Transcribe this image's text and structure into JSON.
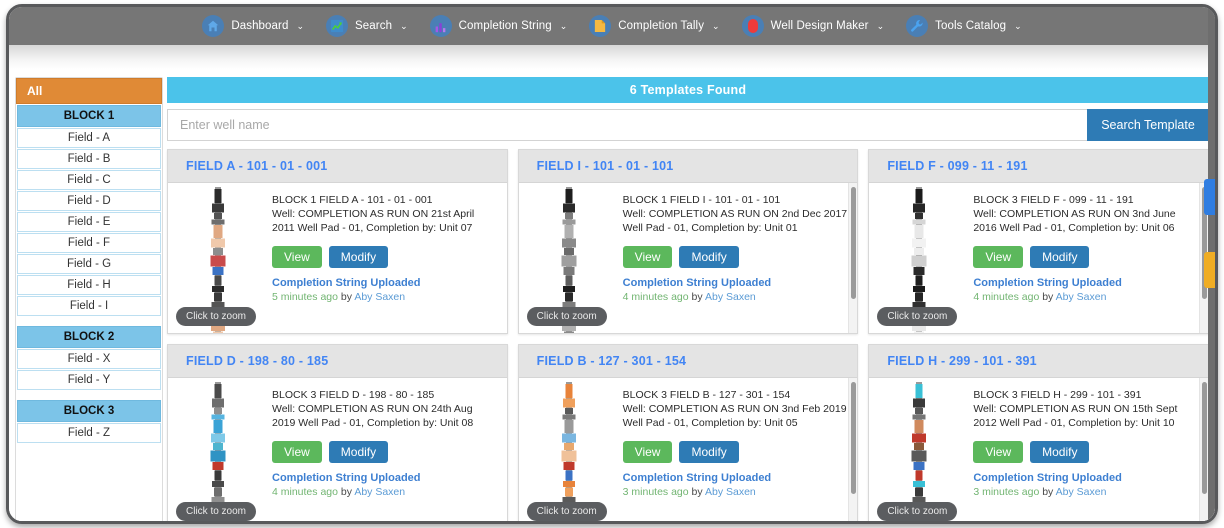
{
  "nav": {
    "items": [
      {
        "label": "Dashboard",
        "icon": "home-icon",
        "caret": "⌄"
      },
      {
        "label": "Search",
        "icon": "chart-line-icon",
        "caret": "⌄"
      },
      {
        "label": "Completion String",
        "icon": "bar-chart-icon",
        "caret": "⌄"
      },
      {
        "label": "Completion Tally",
        "icon": "document-icon",
        "caret": "⌄"
      },
      {
        "label": "Well Design Maker",
        "icon": "capsule-icon",
        "caret": "⌄"
      },
      {
        "label": "Tools Catalog",
        "icon": "wrench-icon",
        "caret": "⌄"
      }
    ]
  },
  "sidebar": {
    "all_label": "All",
    "groups": [
      {
        "block": "BLOCK 1",
        "fields": [
          "Field - A",
          "Field - B",
          "Field - C",
          "Field - D",
          "Field - E",
          "Field - F",
          "Field - G",
          "Field - H",
          "Field - I"
        ]
      },
      {
        "block": "BLOCK 2",
        "fields": [
          "Field - X",
          "Field - Y"
        ]
      },
      {
        "block": "BLOCK 3",
        "fields": [
          "Field - Z"
        ]
      }
    ]
  },
  "main": {
    "found_label": "6 Templates Found",
    "search": {
      "placeholder": "Enter well name",
      "value": "",
      "button_label": "Search Template"
    },
    "labels": {
      "view": "View",
      "modify": "Modify",
      "status": "Completion String Uploaded",
      "by": "by",
      "zoom": "Click to zoom"
    },
    "cards": [
      {
        "title": "FIELD A - 101 - 01 - 001",
        "line1": "BLOCK 1 FIELD A - 101 - 01 - 001",
        "line2": "Well: COMPLETION AS RUN ON 21st April",
        "line3": "2011 Well Pad - 01, Completion by: Unit 07",
        "ago": "5 minutes ago",
        "user": "Aby Saxen",
        "scroll": false
      },
      {
        "title": "FIELD I - 101 - 01 - 101",
        "line1": "BLOCK 1 FIELD I - 101 - 01 - 101",
        "line2": "Well: COMPLETION AS RUN ON 2nd Dec 2017",
        "line3": "Well Pad - 01, Completion by: Unit 01",
        "ago": "4 minutes ago",
        "user": "Aby Saxen",
        "scroll": true
      },
      {
        "title": "FIELD F - 099 - 11 - 191",
        "line1": "BLOCK 3 FIELD F - 099 - 11 - 191",
        "line2": "Well: COMPLETION AS RUN ON 3nd June",
        "line3": "2016 Well Pad - 01, Completion by: Unit 06",
        "ago": "4 minutes ago",
        "user": "Aby Saxen",
        "scroll": true
      },
      {
        "title": "FIELD D - 198 - 80 - 185",
        "line1": "BLOCK 3 FIELD D - 198 - 80 - 185",
        "line2": "Well: COMPLETION AS RUN ON 24th Aug",
        "line3": "2019 Well Pad - 01, Completion by: Unit 08",
        "ago": "4 minutes ago",
        "user": "Aby Saxen",
        "scroll": false
      },
      {
        "title": "FIELD B - 127 - 301 - 154",
        "line1": "BLOCK 3 FIELD B - 127 - 301 - 154",
        "line2": "Well: COMPLETION AS RUN ON 3nd Feb 2019",
        "line3": "Well Pad - 01, Completion by: Unit 05",
        "ago": "3 minutes ago",
        "user": "Aby Saxen",
        "scroll": true
      },
      {
        "title": "FIELD H - 299 - 101 - 391",
        "line1": "BLOCK 3 FIELD H - 299 - 101 - 391",
        "line2": "Well: COMPLETION AS RUN ON 15th Sept",
        "line3": "2012 Well Pad - 01, Completion by: Unit 10",
        "ago": "3 minutes ago",
        "user": "Aby Saxen",
        "scroll": true
      }
    ]
  },
  "edge_tabs": [
    {
      "name": "blue-tab",
      "color": "#2f7de1"
    },
    {
      "name": "yellow-tab",
      "color": "#f0ad23"
    }
  ]
}
